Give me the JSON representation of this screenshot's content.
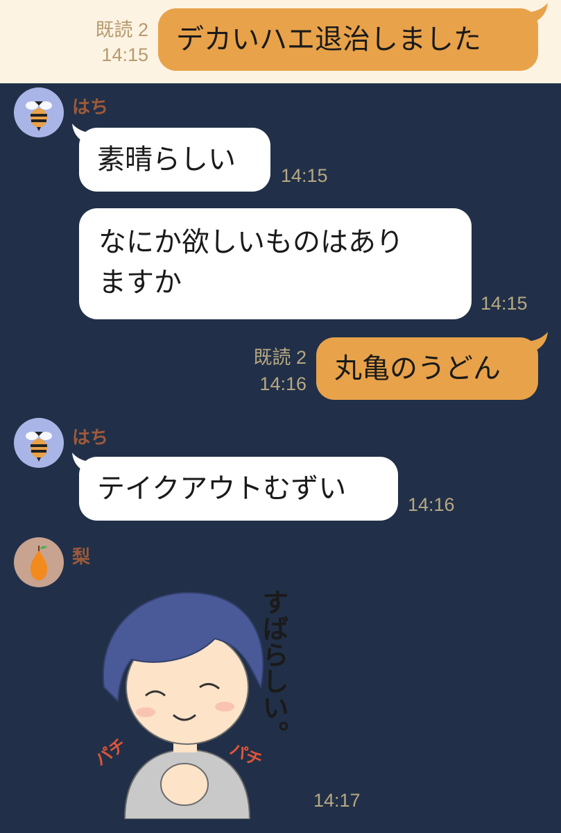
{
  "colors": {
    "background": "#213048",
    "top_strip": "#fcf3e3",
    "outgoing_bubble": "#e8a24a",
    "incoming_bubble": "#ffffff",
    "sender_name": "#9e5a3a",
    "timestamp": "#b8a883"
  },
  "messages": [
    {
      "direction": "out",
      "read_receipt": "既読 2",
      "time": "14:15",
      "text": "デカいハエ退治しました"
    },
    {
      "direction": "in",
      "sender": "はち",
      "avatar": "bee-icon",
      "text": "素晴らしい",
      "time": "14:15"
    },
    {
      "direction": "in",
      "text_line1": "なにか欲しいものはあり",
      "text_line2": "ますか",
      "time": "14:15"
    },
    {
      "direction": "out",
      "read_receipt": "既読 2",
      "time": "14:16",
      "text": "丸亀のうどん"
    },
    {
      "direction": "in",
      "sender": "はち",
      "avatar": "bee-icon",
      "text": "テイクアウトむずい",
      "time": "14:16"
    },
    {
      "direction": "in",
      "sender": "梨",
      "avatar": "pear-icon",
      "sticker": "clapping-boy-sticker",
      "time": "14:17"
    }
  ],
  "sticker_text": {
    "main": "すばらしい。",
    "sfx": "パチ"
  }
}
